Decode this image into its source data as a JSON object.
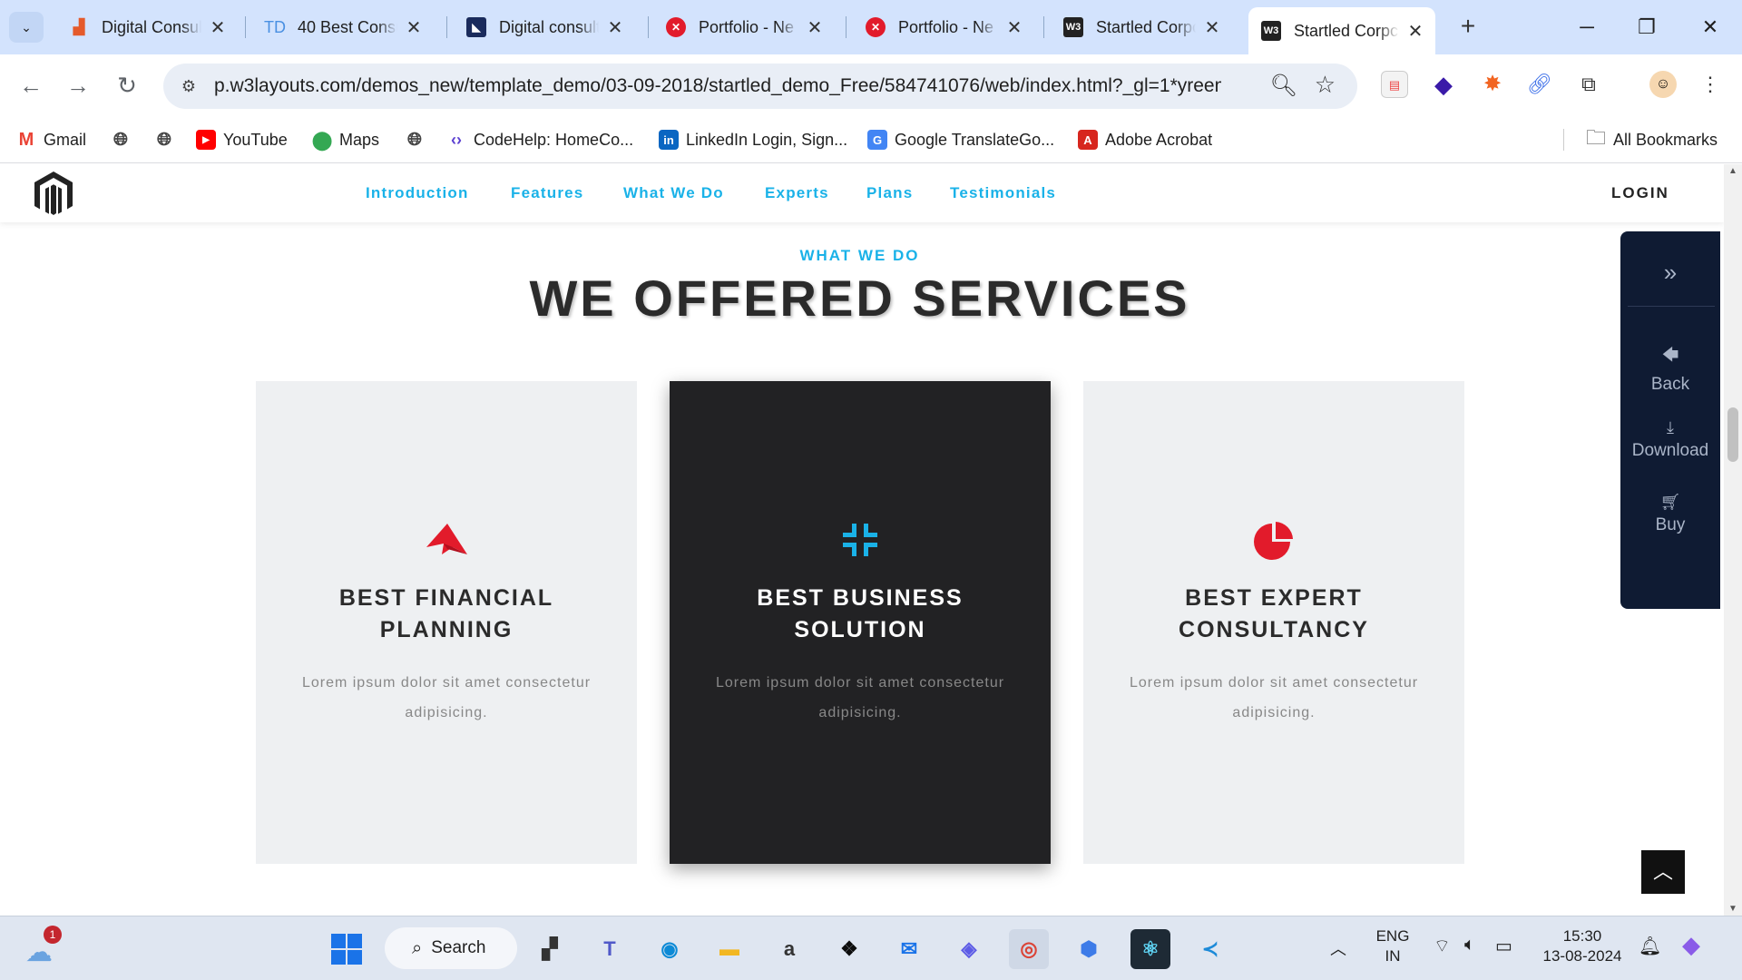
{
  "browser": {
    "tabs": [
      {
        "title": "Digital Consul",
        "favicon": "chart-favicon",
        "favicon_color": "#e55a2b"
      },
      {
        "title": "40 Best Consu",
        "favicon": "td-favicon",
        "favicon_color": "#4a90e2"
      },
      {
        "title": "Digital consult",
        "favicon": "envato-favicon",
        "favicon_color": "#1a2b5c"
      },
      {
        "title": "Portfolio - Ne",
        "favicon": "x-favicon",
        "favicon_color": "#e21b2b"
      },
      {
        "title": "Portfolio - Ne",
        "favicon": "x-favicon",
        "favicon_color": "#e21b2b"
      },
      {
        "title": "Startled Corpc",
        "favicon": "w3-favicon",
        "favicon_color": "#222"
      },
      {
        "title": "Startled Corpc",
        "favicon": "w3-favicon",
        "favicon_color": "#222",
        "active": true
      }
    ],
    "new_tab_label": "+",
    "url": "p.w3layouts.com/demos_new/template_demo/03-09-2018/startled_demo_Free/584741076/web/index.html?_gl=1*yreemi...",
    "bookmarks": [
      {
        "label": "Gmail",
        "icon": "gmail-icon"
      },
      {
        "label": "",
        "icon": "globe-icon"
      },
      {
        "label": "",
        "icon": "globe-icon"
      },
      {
        "label": "YouTube",
        "icon": "youtube-icon"
      },
      {
        "label": "Maps",
        "icon": "maps-icon"
      },
      {
        "label": "",
        "icon": "globe-icon"
      },
      {
        "label": "CodeHelp: HomeCo...",
        "icon": "codehelp-icon"
      },
      {
        "label": "LinkedIn Login, Sign...",
        "icon": "linkedin-icon"
      },
      {
        "label": "Google TranslateGo...",
        "icon": "translate-icon"
      },
      {
        "label": "Adobe Acrobat",
        "icon": "acrobat-icon"
      }
    ],
    "all_bookmarks": "All Bookmarks"
  },
  "site": {
    "nav": [
      "Introduction",
      "Features",
      "What We Do",
      "Experts",
      "Plans",
      "Testimonials"
    ],
    "login": "LOGIN",
    "section_eyebrow": "WHAT WE DO",
    "section_title": "WE OFFERED SERVICES",
    "cards": [
      {
        "title": "BEST FINANCIAL PLANNING",
        "desc": "Lorem ipsum dolor sit amet consectetur adipisicing.",
        "icon": "paper-plane-icon",
        "icon_color": "#e21b2b",
        "dark": false
      },
      {
        "title": "BEST BUSINESS SOLUTION",
        "desc": "Lorem ipsum dolor sit amet consectetur adipisicing.",
        "icon": "compress-icon",
        "icon_color": "#1ab2e8",
        "dark": true
      },
      {
        "title": "BEST EXPERT CONSULTANCY",
        "desc": "Lorem ipsum dolor sit amet consectetur adipisicing.",
        "icon": "pie-chart-icon",
        "icon_color": "#e21b2b",
        "dark": false
      }
    ],
    "side_panel": {
      "back": "Back",
      "download": "Download",
      "buy": "Buy"
    }
  },
  "taskbar": {
    "search_label": "Search",
    "weather_badge": "1",
    "language": "ENG",
    "region": "IN",
    "time": "15:30",
    "date": "13-08-2024"
  },
  "colors": {
    "accent": "#1ab2e8",
    "red": "#e21b2b",
    "dark_card": "#222224",
    "side_panel": "#0f1b33"
  }
}
